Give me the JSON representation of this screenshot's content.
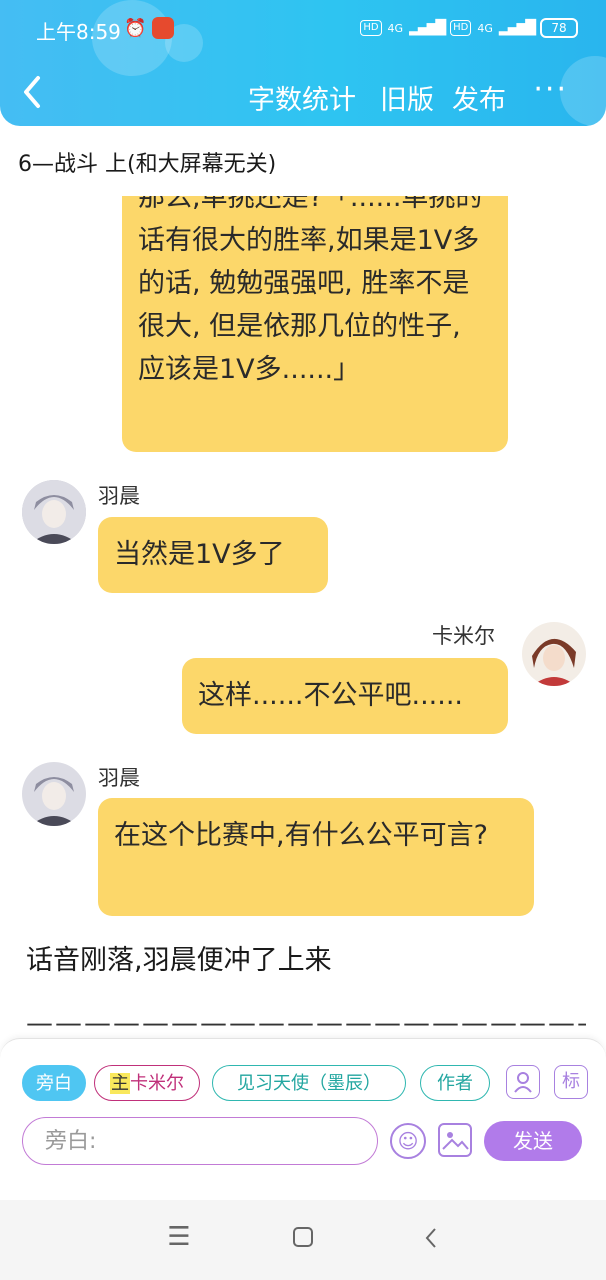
{
  "status_bar": {
    "time": "上午8:59",
    "battery": "78",
    "net_1": "4G",
    "net_2": "4G",
    "hd": "HD"
  },
  "nav": {
    "word_count": "字数统计",
    "old_version": "旧版",
    "publish": "发布",
    "more": "···"
  },
  "chapter_title": "6—战斗 上(和大屏幕无关)",
  "messages": {
    "first_bubble": "那么,单挑还是?「......单挑的话有很大的胜率,如果是1V多的话, 勉勉强强吧, 胜率不是很大, 但是依那几位的性子, 应该是1V多......」",
    "m2_name": "羽晨",
    "m2_text": "当然是1V多了",
    "m3_name": "卡米尔",
    "m3_text": "这样......不公平吧......",
    "m4_name": "羽晨",
    "m4_text": "在这个比赛中,有什么公平可言?"
  },
  "narration": "话音刚落,羽晨便冲了上来",
  "dashes": "——————————————————————————————",
  "roles": {
    "narrator": "旁白",
    "main_mark": "主",
    "camille": "卡米尔",
    "angel": "见习天使（墨辰）",
    "author": "作者"
  },
  "input": {
    "placeholder": "旁白:"
  },
  "send_label": "发送",
  "icons": {
    "tag_label": "标"
  },
  "colors": {
    "accent": "#2ec4f1",
    "bubble": "#fcd76a",
    "send": "#b17bea"
  }
}
